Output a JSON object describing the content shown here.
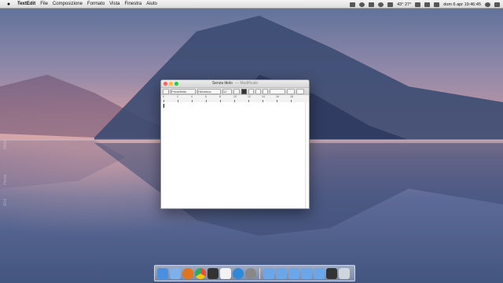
{
  "menubar": {
    "app_name": "TextEdit",
    "items": [
      "File",
      "Composizione",
      "Formato",
      "Vista",
      "Finestra",
      "Aiuto"
    ],
    "status": {
      "temperature": "43° 27°",
      "datetime": "dom 6 apr  19:46:45"
    }
  },
  "desktop": {
    "side_labels": [
      "Hello",
      "Home",
      "Bird"
    ]
  },
  "window": {
    "title": "Senza titolo",
    "edited_label": "— Modificato",
    "toolbar": {
      "style": "Predefinito",
      "font": "Helvetica",
      "size": "12"
    },
    "ruler_numbers": [
      "0",
      "2",
      "4",
      "6",
      "8",
      "10",
      "12",
      "14",
      "16",
      "18"
    ]
  },
  "dock": {
    "items": [
      {
        "name": "finder",
        "color": "#4a8fe0"
      },
      {
        "name": "mail",
        "color": "#7fb1e8"
      },
      {
        "name": "firefox",
        "color": "#e2741b"
      },
      {
        "name": "chrome",
        "color": "#e74c3c"
      },
      {
        "name": "itunes",
        "color": "#333333"
      },
      {
        "name": "textedit",
        "color": "#f2f2f2"
      },
      {
        "name": "appstore",
        "color": "#2f88d8"
      },
      {
        "name": "system-preferences",
        "color": "#888888"
      }
    ],
    "stacks": [
      {
        "name": "folder-1",
        "color": "#6aa6e8"
      },
      {
        "name": "folder-2",
        "color": "#6aa6e8"
      },
      {
        "name": "folder-3",
        "color": "#6aa6e8"
      },
      {
        "name": "folder-4",
        "color": "#6aa6e8"
      },
      {
        "name": "folder-5",
        "color": "#6aa6e8"
      },
      {
        "name": "monitor",
        "color": "#333333"
      },
      {
        "name": "trash",
        "color": "#cfd5dc"
      }
    ]
  }
}
